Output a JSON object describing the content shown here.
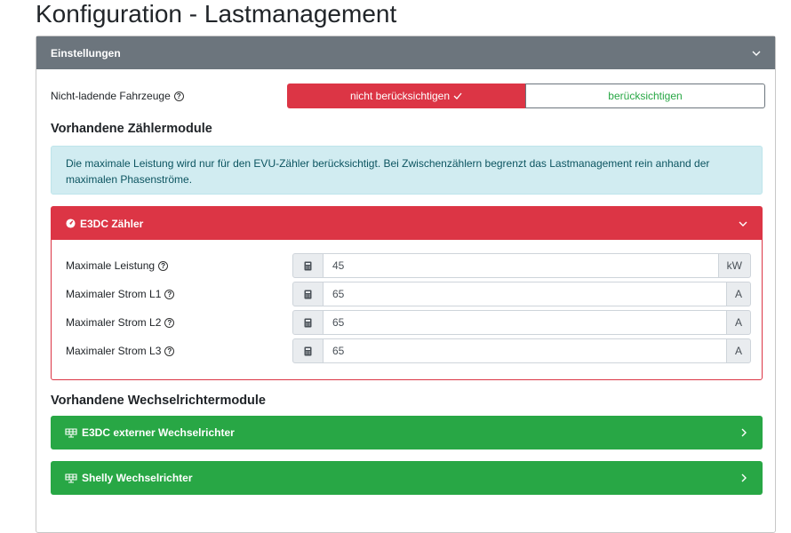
{
  "page_title": "Konfiguration - Lastmanagement",
  "settings": {
    "title": "Einstellungen",
    "non_charging": {
      "label": "Nicht-ladende Fahrzeuge",
      "options": [
        "nicht berücksichtigen",
        "berücksichtigen"
      ],
      "selected": "nicht berücksichtigen"
    },
    "meter_heading": "Vorhandene Zählermodule",
    "meter_info": "Die maximale Leistung wird nur für den EVU-Zähler berücksichtigt. Bei Zwischenzählern begrenzt das Lastmanagement rein anhand der maximalen Phasenströme.",
    "meter": {
      "title": "E3DC Zähler",
      "fields": [
        {
          "label": "Maximale Leistung",
          "value": "45",
          "unit": "kW"
        },
        {
          "label": "Maximaler Strom L1",
          "value": "65",
          "unit": "A"
        },
        {
          "label": "Maximaler Strom L2",
          "value": "65",
          "unit": "A"
        },
        {
          "label": "Maximaler Strom L3",
          "value": "65",
          "unit": "A"
        }
      ]
    },
    "inverter_heading": "Vorhandene Wechselrichtermodule",
    "inverters": [
      {
        "title": "E3DC externer Wechselrichter"
      },
      {
        "title": "Shelly Wechselrichter"
      }
    ]
  }
}
